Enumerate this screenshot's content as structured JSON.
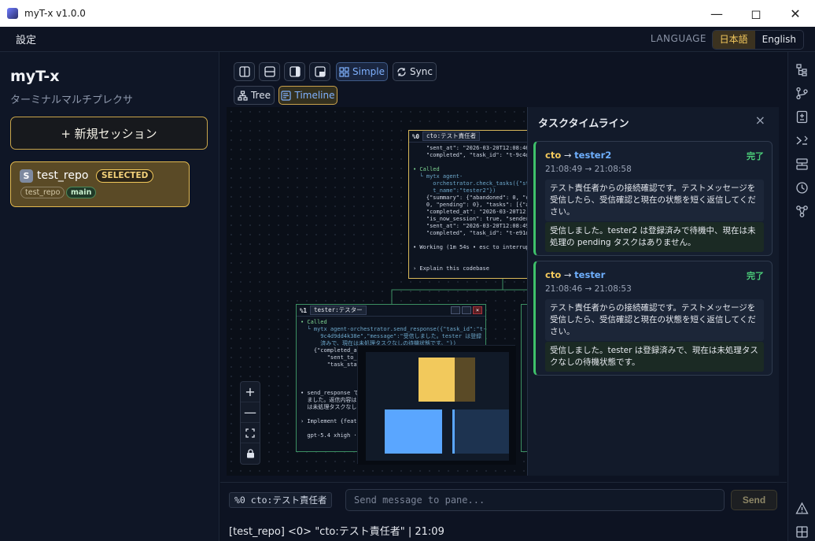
{
  "window": {
    "title": "myT-x v1.0.0"
  },
  "menubar": {
    "settings": "設定",
    "language_label": "LANGUAGE",
    "lang_ja": "日本語",
    "lang_en": "English"
  },
  "sidebar": {
    "brand": "myT-x",
    "subtitle": "ターミナルマルチプレクサ",
    "new_session": "+ 新規セッション",
    "session": {
      "badge": "S",
      "name": "test_repo",
      "selected": "SELECTED",
      "tags": [
        "test_repo",
        "main"
      ]
    }
  },
  "toolbar": {
    "simple": "Simple",
    "sync": "Sync",
    "tree": "Tree",
    "timeline": "Timeline"
  },
  "panes": {
    "p0": {
      "id": "%0",
      "name": "cto:テスト責任者"
    },
    "p1": {
      "id": "%1",
      "name": "tester:テスター"
    }
  },
  "timeline": {
    "title": "タスクタイムライン",
    "close": "×",
    "items": [
      {
        "from": "cto",
        "arrow": " → ",
        "to": "tester2",
        "status": "完了",
        "time": "21:08:49 → 21:08:58",
        "message": "テスト責任者からの接続確認です。テストメッセージを受信したら、受信確認と現在の状態を短く返信してください。",
        "reply": "受信しました。tester2 は登録済みで待機中、現在は未処理の pending タスクはありません。"
      },
      {
        "from": "cto",
        "arrow": " → ",
        "to": "tester",
        "status": "完了",
        "time": "21:08:46 → 21:08:53",
        "message": "テスト責任者からの接続確認です。テストメッセージを受信したら、受信確認と現在の状態を短く返信してください。",
        "reply": "受信しました。tester は登録済みで、現在は未処理タスクなしの待機状態です。"
      }
    ]
  },
  "input": {
    "pane_tag": "%0 cto:テスト責任者",
    "placeholder": "Send message to pane...",
    "send": "Send"
  },
  "status": {
    "text": "[test_repo] <0> \"cto:テスト責任者\" | 21:09"
  }
}
